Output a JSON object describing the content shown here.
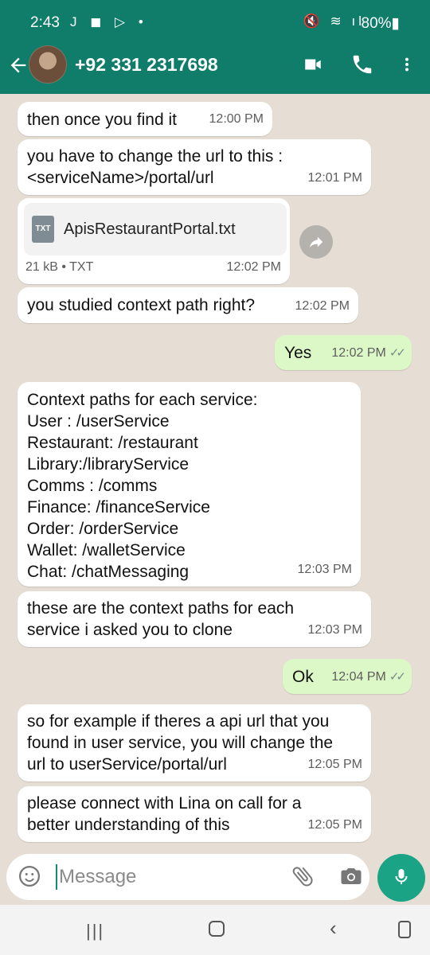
{
  "status_bar": {
    "time": "2:43",
    "left_icons": "J ◼ ▷ •",
    "right_icons": "🔇 ≋ ıl",
    "battery": "80%▮"
  },
  "header": {
    "contact": "+92 331 2317698",
    "icons": [
      "back-arrow-icon",
      "avatar",
      "video-call-icon",
      "voice-call-icon",
      "more-menu-icon"
    ]
  },
  "messages": [
    {
      "text": "then once you find it",
      "time": "12:00 PM",
      "dir": "in"
    },
    {
      "text": "you have to change the url to this :\n<serviceName>/portal/url",
      "time": "12:01 PM",
      "dir": "in"
    },
    {
      "type": "file",
      "file_name": "ApisRestaurantPortal.txt",
      "file_icon": "TXT",
      "meta": "21 kB • TXT",
      "time": "12:02 PM",
      "dir": "in"
    },
    {
      "text": "you studied context path right?",
      "time": "12:02 PM",
      "dir": "in"
    },
    {
      "text": "Yes",
      "time": "12:02 PM",
      "dir": "out",
      "ticks": "✓✓"
    },
    {
      "text": "Context paths for each service:\nUser : /userService\nRestaurant: /restaurant\nLibrary:/libraryService\nComms : /comms\nFinance: /financeService\nOrder: /orderService\nWallet: /walletService\nChat: /chatMessaging",
      "time": "12:03 PM",
      "dir": "in"
    },
    {
      "text": "these are the context paths for each\nservice i asked you to clone",
      "time": "12:03 PM",
      "dir": "in"
    },
    {
      "text": "Ok",
      "time": "12:04 PM",
      "dir": "out",
      "ticks": "✓✓"
    },
    {
      "text": "so for example if theres a api url that you\nfound in user service, you will change the\nurl to userService/portal/url",
      "time": "12:05 PM",
      "dir": "in"
    },
    {
      "text": "please connect with Lina on call for a\nbetter understanding of this",
      "time": "12:05 PM",
      "dir": "in"
    }
  ],
  "input": {
    "placeholder": "Message"
  },
  "colors": {
    "header": "#0f7d69",
    "outgoing_bubble": "#dcf8c6",
    "mic_button": "#1aa385"
  }
}
